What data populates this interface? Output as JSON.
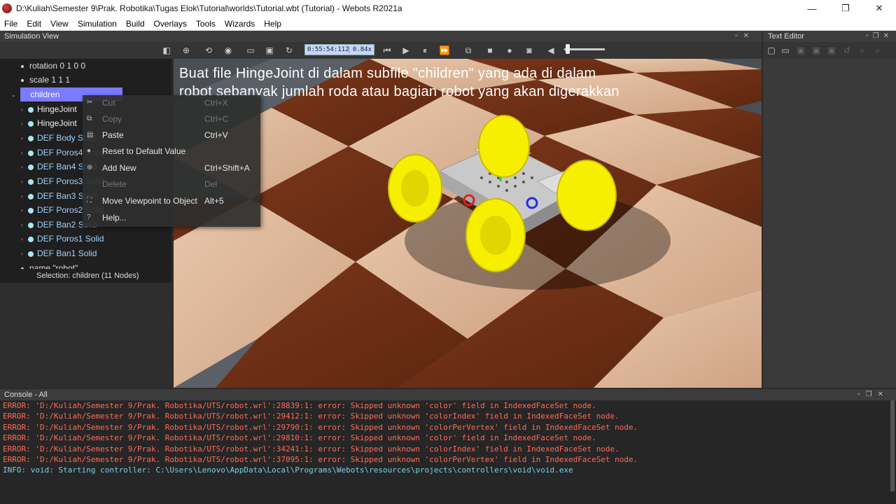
{
  "window": {
    "title": "D:\\Kuliah\\Semester 9\\Prak. Robotika\\Tugas Elok\\Tutorial\\worlds\\Tutorial.wbt (Tutorial) - Webots R2021a",
    "minimize": "—",
    "maximize": "❐",
    "close": "✕"
  },
  "menu": [
    "File",
    "Edit",
    "View",
    "Simulation",
    "Build",
    "Overlays",
    "Tools",
    "Wizards",
    "Help"
  ],
  "panels": {
    "simulation_view": "Simulation View",
    "text_editor": "Text Editor",
    "console": "Console - All"
  },
  "toolbar": {
    "time": "0:55:54:112",
    "speed": "0.84x"
  },
  "tree": {
    "rows": [
      {
        "text": "rotation 0 1 0 0"
      },
      {
        "text": "scale 1 1 1"
      },
      {
        "text": "children"
      },
      {
        "text": "HingeJoint"
      },
      {
        "text": "HingeJoint"
      },
      {
        "text": "DEF Body Solid"
      },
      {
        "text": "DEF Poros4 Solid"
      },
      {
        "text": "DEF Ban4 Solid"
      },
      {
        "text": "DEF Poros3 Solid"
      },
      {
        "text": "DEF Ban3 Solid"
      },
      {
        "text": "DEF Poros2 Solid"
      },
      {
        "text": "DEF Ban2 Solid"
      },
      {
        "text": "DEF Poros1 Solid"
      },
      {
        "text": "DEF Ban1 Solid"
      },
      {
        "text": "name \"robot\""
      }
    ],
    "selection": "Selection: children (11 Nodes)"
  },
  "context_menu": [
    {
      "label": "Cut",
      "shortcut": "Ctrl+X",
      "enabled": false
    },
    {
      "label": "Copy",
      "shortcut": "Ctrl+C",
      "enabled": false
    },
    {
      "label": "Paste",
      "shortcut": "Ctrl+V",
      "enabled": true
    },
    {
      "label": "Reset to Default Value",
      "shortcut": "",
      "enabled": true
    },
    {
      "label": "Add New",
      "shortcut": "Ctrl+Shift+A",
      "enabled": true
    },
    {
      "label": "Delete",
      "shortcut": "Del",
      "enabled": false
    },
    {
      "label": "Move Viewpoint to Object",
      "shortcut": "Alt+5",
      "enabled": true
    },
    {
      "label": "Help...",
      "shortcut": "",
      "enabled": true
    }
  ],
  "caption": "Buat file HingeJoint di dalam subfile \"children\" yang ada di dalam robot sebanyak jumlah roda atau bagian robot yang akan digerakkan",
  "console": [
    {
      "type": "error",
      "text": "ERROR: 'D:/Kuliah/Semester 9/Prak. Robotika/UTS/robot.wrl':28839:1: error: Skipped unknown 'color' field in IndexedFaceSet node."
    },
    {
      "type": "error",
      "text": "ERROR: 'D:/Kuliah/Semester 9/Prak. Robotika/UTS/robot.wrl':29412:1: error: Skipped unknown 'colorIndex' field in IndexedFaceSet node."
    },
    {
      "type": "error",
      "text": "ERROR: 'D:/Kuliah/Semester 9/Prak. Robotika/UTS/robot.wrl':29790:1: error: Skipped unknown 'colorPerVertex' field in IndexedFaceSet node."
    },
    {
      "type": "error",
      "text": "ERROR: 'D:/Kuliah/Semester 9/Prak. Robotika/UTS/robot.wrl':29810:1: error: Skipped unknown 'color' field in IndexedFaceSet node."
    },
    {
      "type": "error",
      "text": "ERROR: 'D:/Kuliah/Semester 9/Prak. Robotika/UTS/robot.wrl':34241:1: error: Skipped unknown 'colorIndex' field in IndexedFaceSet node."
    },
    {
      "type": "error",
      "text": "ERROR: 'D:/Kuliah/Semester 9/Prak. Robotika/UTS/robot.wrl':37095:1: error: Skipped unknown 'colorPerVertex' field in IndexedFaceSet node."
    },
    {
      "type": "info",
      "text": "INFO: void: Starting controller: C:\\Users\\Lenovo\\AppData\\Local\\Programs\\Webots\\resources\\projects\\controllers\\void\\void.exe"
    }
  ],
  "colors": {
    "selection": "#7a7bff",
    "error": "#ff6a5a",
    "info": "#7ad0e8",
    "wheel": "#f7ef00",
    "floor_dark": "#6b2e14",
    "floor_light": "#d9b496"
  }
}
